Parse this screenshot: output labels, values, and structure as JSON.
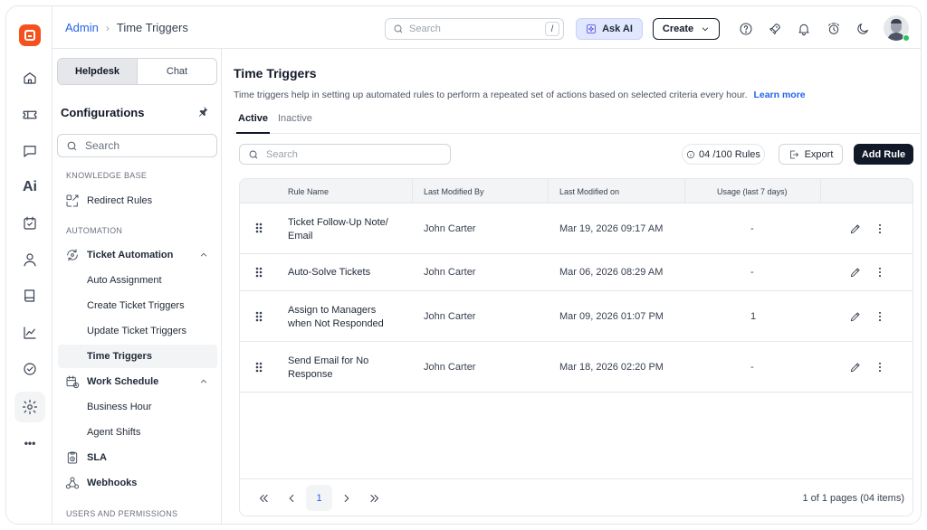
{
  "breadcrumb": {
    "root": "Admin",
    "current": "Time Triggers"
  },
  "topbar": {
    "search_placeholder": "Search",
    "search_shortcut": "/",
    "ask_ai_label": "Ask AI",
    "create_label": "Create",
    "icons": [
      "help-icon",
      "rocket-icon",
      "bell-icon",
      "timer-icon",
      "moon-icon"
    ]
  },
  "rail": {
    "icons": [
      "home-icon",
      "ticket-icon",
      "chat-icon",
      "ai-icon",
      "calendar-check-icon",
      "user-icon",
      "book-icon",
      "chart-icon",
      "check-circle-icon",
      "settings-icon",
      "more-icon"
    ],
    "ai_label": "Ai",
    "more_label": "•••"
  },
  "config": {
    "toggle": {
      "helpdesk": "Helpdesk",
      "chat": "Chat"
    },
    "title": "Configurations",
    "search_placeholder": "Search",
    "sections": {
      "knowledge_base": "KNOWLEDGE BASE",
      "automation": "AUTOMATION",
      "users_permissions": "USERS AND PERMISSIONS"
    },
    "items": {
      "redirect_rules": "Redirect Rules",
      "ticket_automation": "Ticket Automation",
      "auto_assignment": "Auto Assignment",
      "create_ticket_triggers": "Create Ticket Triggers",
      "update_ticket_triggers": "Update Ticket Triggers",
      "time_triggers": "Time Triggers",
      "work_schedule": "Work Schedule",
      "business_hour": "Business Hour",
      "agent_shifts": "Agent Shifts",
      "sla": "SLA",
      "webhooks": "Webhooks"
    }
  },
  "main": {
    "title": "Time Triggers",
    "description": "Time triggers help in setting up automated rules to perform a repeated set of actions based on selected criteria every hour.",
    "learn_more": "Learn more",
    "tabs": {
      "active": "Active",
      "inactive": "Inactive"
    },
    "search_placeholder": "Search",
    "rule_count": "04 /100 Rules",
    "export_label": "Export",
    "add_rule_label": "Add Rule"
  },
  "table": {
    "columns": {
      "name": "Rule Name",
      "modified_by": "Last Modified By",
      "modified_on": "Last Modified on",
      "usage": "Usage (last 7 days)"
    },
    "rows": [
      {
        "name1": "Ticket Follow-Up Note/",
        "name2": "Email",
        "by": "John Carter",
        "on": "Mar 19, 2026 09:17 AM",
        "usage": "-"
      },
      {
        "name1": "Auto-Solve Tickets",
        "name2": "",
        "by": "John Carter",
        "on": "Mar 06, 2026 08:29 AM",
        "usage": "-"
      },
      {
        "name1": "Assign to Managers",
        "name2": "when Not Responded",
        "by": "John Carter",
        "on": "Mar 09, 2026 01:07 PM",
        "usage": "1"
      },
      {
        "name1": "Send Email for No",
        "name2": "Response",
        "by": "John Carter",
        "on": "Mar 18, 2026 02:20 PM",
        "usage": "-"
      }
    ]
  },
  "pagination": {
    "current_page": "1",
    "info": "1 of 1 pages (04 items)"
  }
}
